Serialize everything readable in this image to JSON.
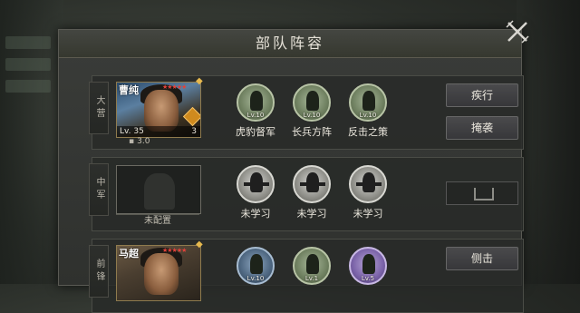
{
  "panel": {
    "title": "部队阵容"
  },
  "rows": [
    {
      "tag": "大营",
      "hero": {
        "name": "曹纯",
        "level": "Lv. 35",
        "cost": "3",
        "cost_line": "3.0"
      },
      "skills": [
        {
          "name": "虎豹督军",
          "lv": "Lv.10"
        },
        {
          "name": "长兵方阵",
          "lv": "Lv.10"
        },
        {
          "name": "反击之策",
          "lv": "Lv.10"
        }
      ],
      "actions": [
        "疾行",
        "掩袭"
      ]
    },
    {
      "tag": "中军",
      "empty_label": "未配置",
      "skills": [
        {
          "name": "未学习"
        },
        {
          "name": "未学习"
        },
        {
          "name": "未学习"
        }
      ]
    },
    {
      "tag": "前锋",
      "hero": {
        "name": "马超"
      },
      "skills": [
        {
          "lv": "Lv.10"
        },
        {
          "lv": "Lv.1"
        },
        {
          "lv": "Lv.5"
        }
      ],
      "actions": [
        "侧击"
      ]
    }
  ]
}
